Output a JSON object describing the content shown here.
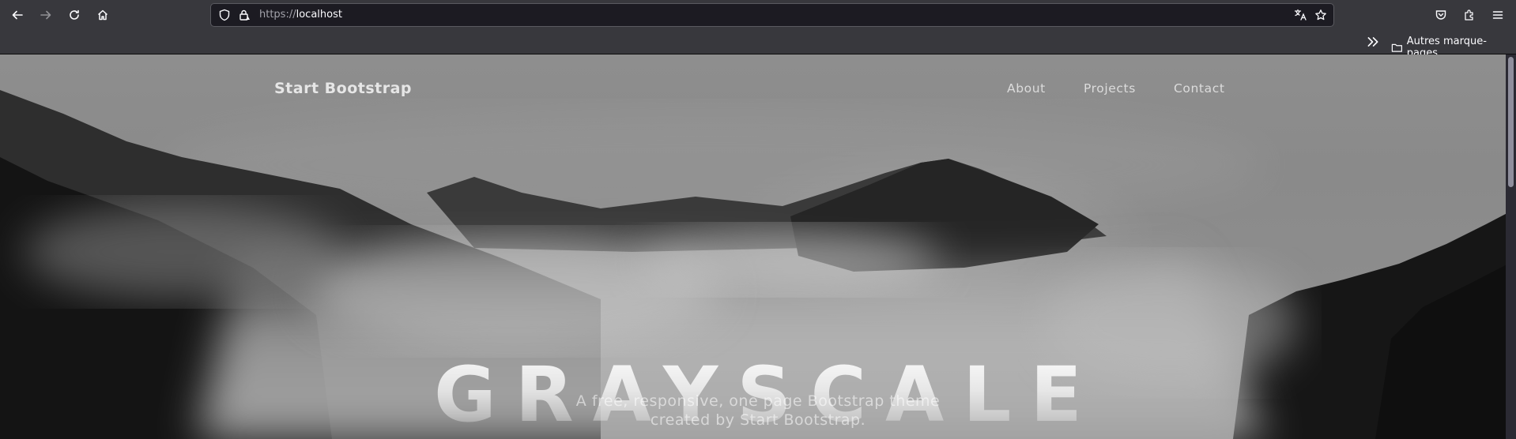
{
  "browser": {
    "url_scheme": "https://",
    "url_host": "localhost",
    "icons": {
      "back": "arrow-left-icon",
      "forward": "arrow-right-icon",
      "reload": "reload-icon",
      "home": "home-icon",
      "tracking": "shield-icon",
      "site_info": "lock-icon",
      "translate": "translate-icon",
      "bookmark": "star-icon",
      "pocket": "pocket-icon",
      "extensions": "puzzle-icon",
      "menu": "hamburger-icon"
    },
    "bookmarks": {
      "folder_label": "Autres marque-pages"
    }
  },
  "page": {
    "brand": "Start Bootstrap",
    "nav": [
      {
        "label": "About"
      },
      {
        "label": "Projects"
      },
      {
        "label": "Contact"
      }
    ],
    "hero": {
      "title": "GRAYSCALE",
      "subtitle_line1": "A free, responsive, one page Bootstrap theme",
      "subtitle_line2": "created by Start Bootstrap."
    }
  }
}
